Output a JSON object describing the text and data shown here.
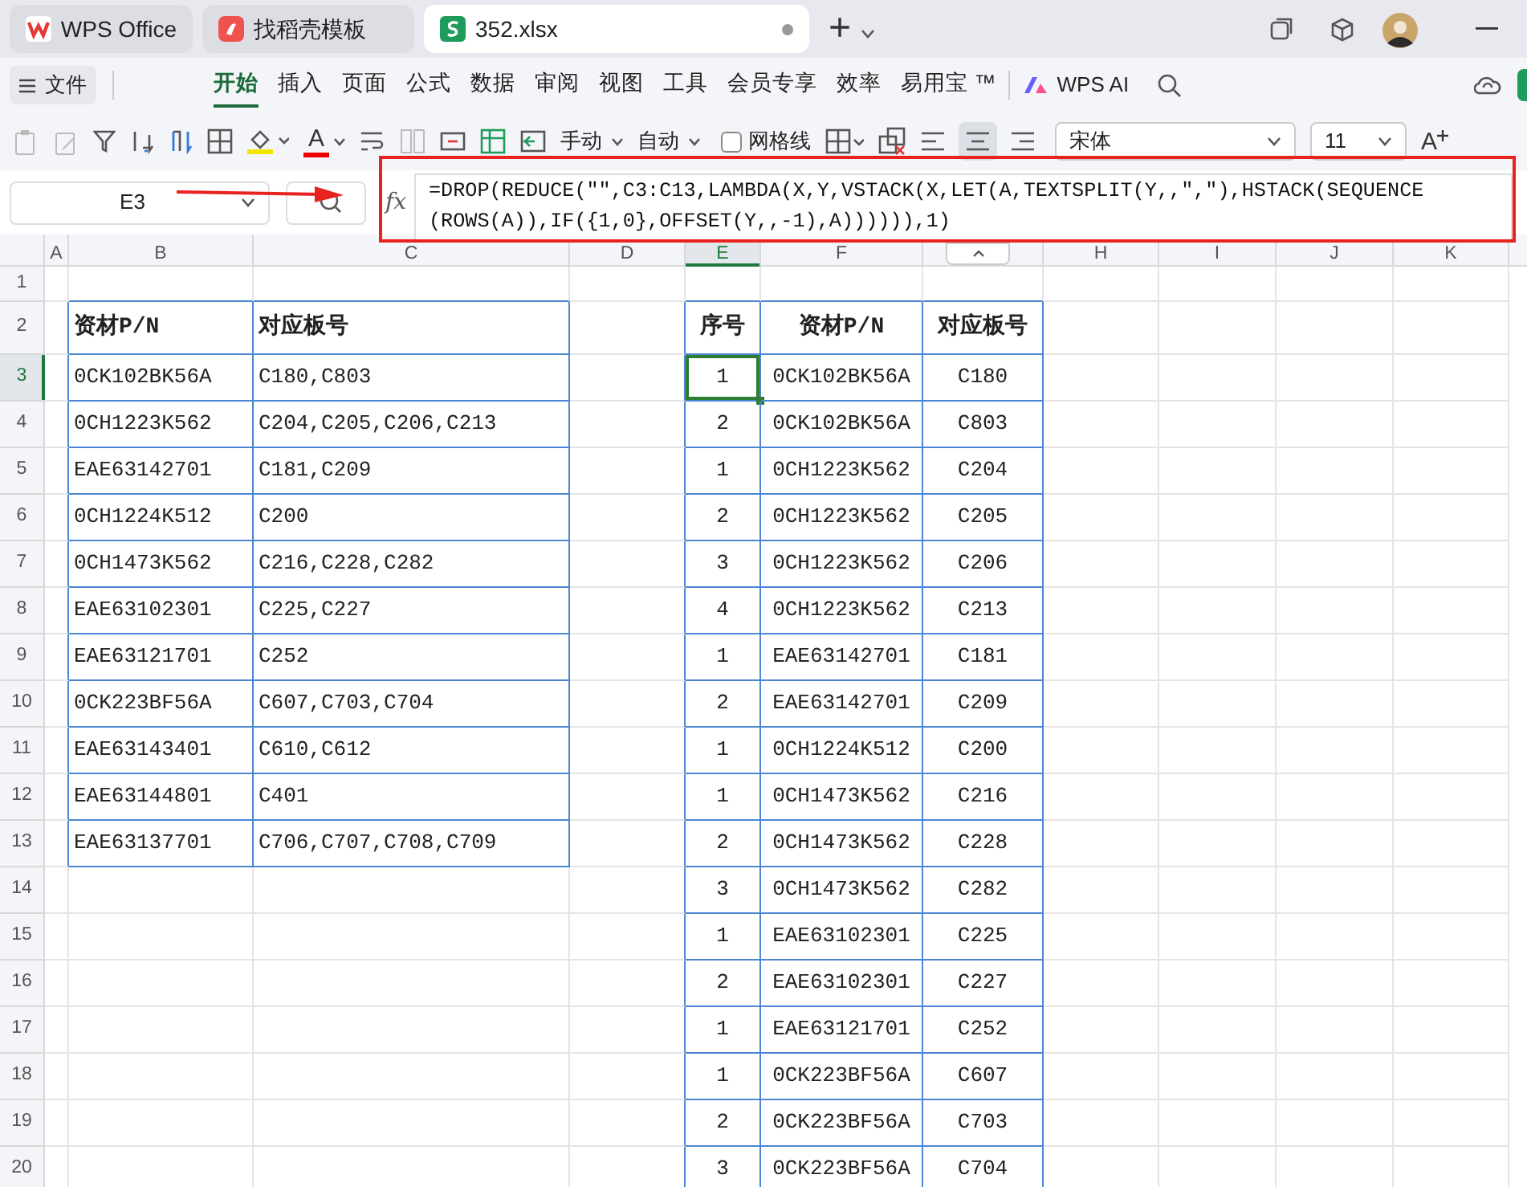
{
  "tabs": [
    {
      "kind": "home",
      "label": "WPS Office",
      "selected": false
    },
    {
      "kind": "template",
      "label": "找稻壳模板",
      "selected": false
    },
    {
      "kind": "sheet",
      "label": "352.xlsx",
      "selected": true
    }
  ],
  "new_tab": "+",
  "menu": {
    "file": "文件",
    "items": [
      {
        "label": "开始",
        "selected": true
      },
      {
        "label": "插入",
        "selected": false
      },
      {
        "label": "页面",
        "selected": false
      },
      {
        "label": "公式",
        "selected": false
      },
      {
        "label": "数据",
        "selected": false
      },
      {
        "label": "审阅",
        "selected": false
      },
      {
        "label": "视图",
        "selected": false
      },
      {
        "label": "工具",
        "selected": false
      },
      {
        "label": "会员专享",
        "selected": false
      },
      {
        "label": "效率",
        "selected": false
      },
      {
        "label": "易用宝 ™",
        "selected": false
      }
    ],
    "ai": "WPS AI"
  },
  "toolbar": {
    "font_color": "A",
    "row_height": "手动",
    "col_width": "自动",
    "gridlines": {
      "label": "网格线",
      "checked": false
    },
    "font": "宋体",
    "size": "11",
    "grow_font": "A"
  },
  "formula_bar": {
    "name_box": "E3",
    "fx": "fx",
    "formula": "=DROP(REDUCE(\"\",C3:C13,LAMBDA(X,Y,VSTACK(X,LET(A,TEXTSPLIT(Y,,\",\"),HSTACK(SEQUENCE(ROWS(A)),IF({1,0},OFFSET(Y,,-1),A)))))),1)"
  },
  "columns": [
    {
      "label": "A",
      "selected": false
    },
    {
      "label": "B",
      "selected": false
    },
    {
      "label": "C",
      "selected": false
    },
    {
      "label": "D",
      "selected": false
    },
    {
      "label": "E",
      "selected": true
    },
    {
      "label": "F",
      "selected": false
    },
    {
      "kind": "collapse"
    },
    {
      "label": "H",
      "selected": false
    },
    {
      "label": "I",
      "selected": false
    },
    {
      "label": "J",
      "selected": false
    },
    {
      "label": "K",
      "selected": false
    }
  ],
  "row_numbers": [
    {
      "label": "1",
      "selected": false
    },
    {
      "label": "2",
      "selected": false
    },
    {
      "label": "3",
      "selected": true
    },
    {
      "label": "4",
      "selected": false
    },
    {
      "label": "5",
      "selected": false
    },
    {
      "label": "6",
      "selected": false
    },
    {
      "label": "7",
      "selected": false
    },
    {
      "label": "8",
      "selected": false
    },
    {
      "label": "9",
      "selected": false
    },
    {
      "label": "10",
      "selected": false
    },
    {
      "label": "11",
      "selected": false
    },
    {
      "label": "12",
      "selected": false
    },
    {
      "label": "13",
      "selected": false
    },
    {
      "label": "14",
      "selected": false
    },
    {
      "label": "15",
      "selected": false
    },
    {
      "label": "16",
      "selected": false
    },
    {
      "label": "17",
      "selected": false
    },
    {
      "label": "18",
      "selected": false
    },
    {
      "label": "19",
      "selected": false
    },
    {
      "label": "20",
      "selected": false
    }
  ],
  "left_table": {
    "header": [
      "资材P/N",
      "对应板号"
    ],
    "rows": [
      [
        "0CK102BK56A",
        "C180,C803"
      ],
      [
        "0CH1223K562",
        "C204,C205,C206,C213"
      ],
      [
        "EAE63142701",
        "C181,C209"
      ],
      [
        "0CH1224K512",
        "C200"
      ],
      [
        "0CH1473K562",
        "C216,C228,C282"
      ],
      [
        "EAE63102301",
        "C225,C227"
      ],
      [
        "EAE63121701",
        "C252"
      ],
      [
        "0CK223BF56A",
        "C607,C703,C704"
      ],
      [
        "EAE63143401",
        "C610,C612"
      ],
      [
        "EAE63144801",
        "C401"
      ],
      [
        "EAE63137701",
        "C706,C707,C708,C709"
      ]
    ]
  },
  "right_table": {
    "header": [
      "序号",
      "资材P/N",
      "对应板号"
    ],
    "rows": [
      {
        "cells": [
          "1",
          "0CK102BK56A",
          "C180"
        ],
        "selected": true
      },
      {
        "cells": [
          "2",
          "0CK102BK56A",
          "C803"
        ],
        "selected": false
      },
      {
        "cells": [
          "1",
          "0CH1223K562",
          "C204"
        ],
        "selected": false
      },
      {
        "cells": [
          "2",
          "0CH1223K562",
          "C205"
        ],
        "selected": false
      },
      {
        "cells": [
          "3",
          "0CH1223K562",
          "C206"
        ],
        "selected": false
      },
      {
        "cells": [
          "4",
          "0CH1223K562",
          "C213"
        ],
        "selected": false
      },
      {
        "cells": [
          "1",
          "EAE63142701",
          "C181"
        ],
        "selected": false
      },
      {
        "cells": [
          "2",
          "EAE63142701",
          "C209"
        ],
        "selected": false
      },
      {
        "cells": [
          "1",
          "0CH1224K512",
          "C200"
        ],
        "selected": false
      },
      {
        "cells": [
          "1",
          "0CH1473K562",
          "C216"
        ],
        "selected": false
      },
      {
        "cells": [
          "2",
          "0CH1473K562",
          "C228"
        ],
        "selected": false
      },
      {
        "cells": [
          "3",
          "0CH1473K562",
          "C282"
        ],
        "selected": false
      },
      {
        "cells": [
          "1",
          "EAE63102301",
          "C225"
        ],
        "selected": false
      },
      {
        "cells": [
          "2",
          "EAE63102301",
          "C227"
        ],
        "selected": false
      },
      {
        "cells": [
          "1",
          "EAE63121701",
          "C252"
        ],
        "selected": false
      },
      {
        "cells": [
          "1",
          "0CK223BF56A",
          "C607"
        ],
        "selected": false
      },
      {
        "cells": [
          "2",
          "0CK223BF56A",
          "C703"
        ],
        "selected": false
      },
      {
        "cells": [
          "3",
          "0CK223BF56A",
          "C704"
        ],
        "selected": false
      }
    ]
  }
}
